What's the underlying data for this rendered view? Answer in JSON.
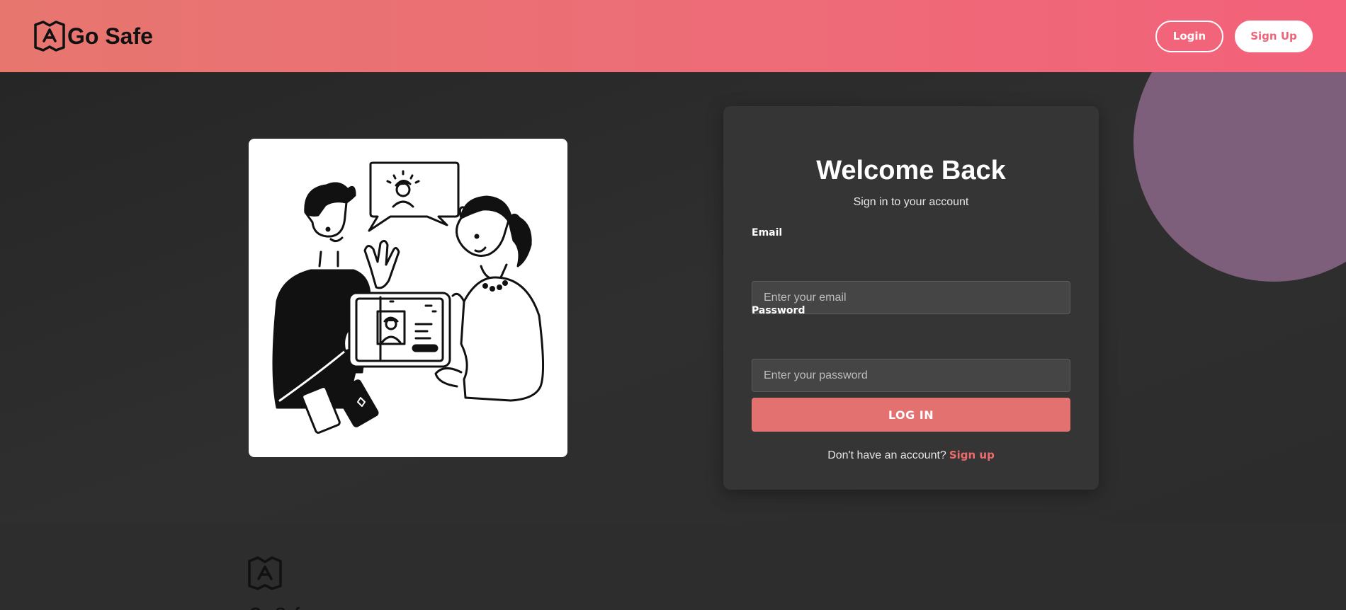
{
  "brand": {
    "name": "Go Safe",
    "logo_icon": "map-logo-icon"
  },
  "nav": {
    "login_label": "Login",
    "signup_label": "Sign Up"
  },
  "colors": {
    "nav_gradient_start": "#e7766f",
    "nav_gradient_end": "#f3617a",
    "accent": "#e27170",
    "card_bg": "#353535",
    "page_bg": "#2c2c2c",
    "deco_circle": "#7d5f7c"
  },
  "illustration": {
    "icon": "people-with-tablet-illustration"
  },
  "login_card": {
    "title": "Welcome Back",
    "subtitle": "Sign in to your account",
    "email_label": "Email",
    "email_placeholder": "Enter your email",
    "email_value": "",
    "password_label": "Password",
    "password_placeholder": "Enter your password",
    "password_value": "",
    "submit_label": "LOG IN",
    "signup_prompt": "Don't have an account?",
    "signup_link": "Sign up"
  },
  "footer": {
    "logo_icon": "map-logo-icon",
    "brand_name": "Go Safe"
  }
}
